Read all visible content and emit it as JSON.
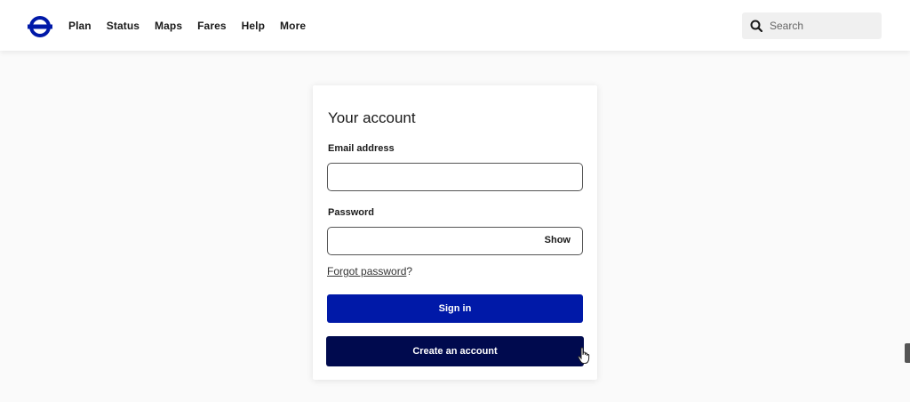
{
  "header": {
    "nav": [
      "Plan",
      "Status",
      "Maps",
      "Fares",
      "Help",
      "More"
    ],
    "search": {
      "placeholder": "Search",
      "value": "",
      "icon": "search-icon"
    },
    "logo_icon": "roundel-logo-icon"
  },
  "login": {
    "title": "Your account",
    "email_label": "Email address",
    "email_value": "",
    "password_label": "Password",
    "password_value": "",
    "show_label": "Show",
    "forgot_link": "Forgot password",
    "forgot_suffix": "?",
    "sign_in_label": "Sign in",
    "create_account_label": "Create an account"
  },
  "colors": {
    "primary": "#0019a8",
    "secondary": "#000a4e",
    "brand": "#0019a8"
  }
}
